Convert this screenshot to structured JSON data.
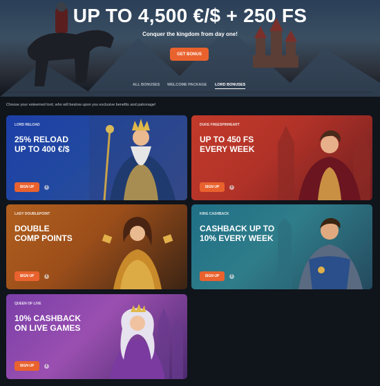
{
  "hero": {
    "title": "UP TO 4,500 €/$ + 250 FS",
    "subtitle": "Conquer the kingdom from day one!",
    "button_label": "GET BONUS"
  },
  "tabs": [
    {
      "label": "ALL BONUSES",
      "active": false
    },
    {
      "label": "WELCOME PACKAGE",
      "active": false
    },
    {
      "label": "LORD BONUSES",
      "active": true
    }
  ],
  "intro_text": "Choose your esteemed lord, who will bestow upon you exclusive benefits and patronage!",
  "cards": [
    {
      "kicker": "LORD RELOAD",
      "line1": "25% RELOAD",
      "line2": "UP TO 400 €/$",
      "button": "SIGN UP",
      "info": "i",
      "color": "#1c3fa8"
    },
    {
      "kicker": "DUKE FREESPINHEART",
      "line1": "UP TO 450 FS",
      "line2": "EVERY WEEK",
      "button": "SIGN UP",
      "info": "i",
      "color": "#c23a2a"
    },
    {
      "kicker": "LADY DOUBLEPOINT",
      "line1": "DOUBLE",
      "line2": "COMP POINTS",
      "button": "SIGN UP",
      "info": "i",
      "color": "#b05f1e"
    },
    {
      "kicker": "KING CASHBACK",
      "line1": "CASHBACK UP TO",
      "line2": "10% EVERY WEEK",
      "button": "SIGN UP",
      "info": "i",
      "color": "#1f6f86"
    },
    {
      "kicker": "QUEEN OF LIVE",
      "line1": "10% CASHBACK",
      "line2": "ON LIVE GAMES",
      "button": "SIGN UP",
      "info": "i",
      "color": "#7a3fa8"
    }
  ],
  "accent_color": "#e9622e",
  "icons": [
    "info-icon",
    "knight-on-horse-illustration",
    "castle-illustration"
  ]
}
